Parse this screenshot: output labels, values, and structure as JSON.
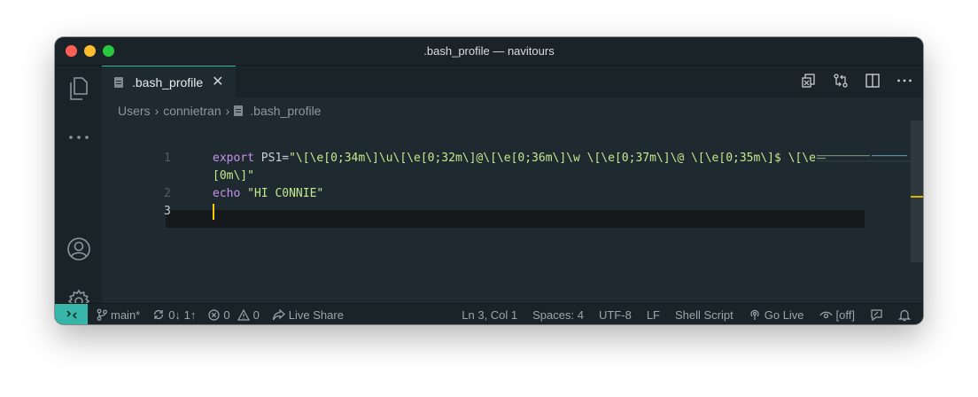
{
  "window": {
    "title": ".bash_profile — navitours"
  },
  "activity_bar": {
    "items": [
      {
        "icon": "explorer-icon"
      },
      {
        "icon": "more-icon"
      },
      {
        "icon": "account-icon"
      },
      {
        "icon": "settings-gear-icon"
      }
    ]
  },
  "tab": {
    "label": ".bash_profile",
    "close_glyph": "✕"
  },
  "tab_actions": [
    {
      "icon": "open-changes-icon"
    },
    {
      "icon": "source-control-compare-icon"
    },
    {
      "icon": "split-editor-icon"
    },
    {
      "icon": "more-actions-icon"
    }
  ],
  "breadcrumbs": {
    "items": [
      "Users",
      "connietran",
      ".bash_profile"
    ]
  },
  "editor": {
    "lines": [
      {
        "number": "1",
        "keyword": "export",
        "var": " PS1=",
        "string": "\"\\[\\e[0;34m\\]\\u\\[\\e[0;32m\\]@\\[\\e[0;36m\\]\\w \\[\\e[0;37m\\]\\@ \\[\\e[0;35m\\]$ \\[\\e"
      },
      {
        "number": "",
        "keyword": "",
        "var": "",
        "string": "[0m\\]\""
      },
      {
        "number": "2",
        "keyword": "echo",
        "var": " ",
        "string": "\"HI C0NNIE\""
      },
      {
        "number": "3",
        "keyword": "",
        "var": "",
        "string": ""
      }
    ]
  },
  "status_bar": {
    "branch": "main*",
    "sync": "0↓ 1↑",
    "errors": "0",
    "warnings": "0",
    "live_share": "Live Share",
    "position": "Ln 3, Col 1",
    "spaces": "Spaces: 4",
    "encoding": "UTF-8",
    "eol": "LF",
    "language": "Shell Script",
    "go_live": "Go Live",
    "off": "[off]"
  },
  "colors": {
    "accent": "#36b5a8",
    "keyword": "#c792ea",
    "string": "#c3e88d",
    "cursor": "#ffcc00"
  }
}
